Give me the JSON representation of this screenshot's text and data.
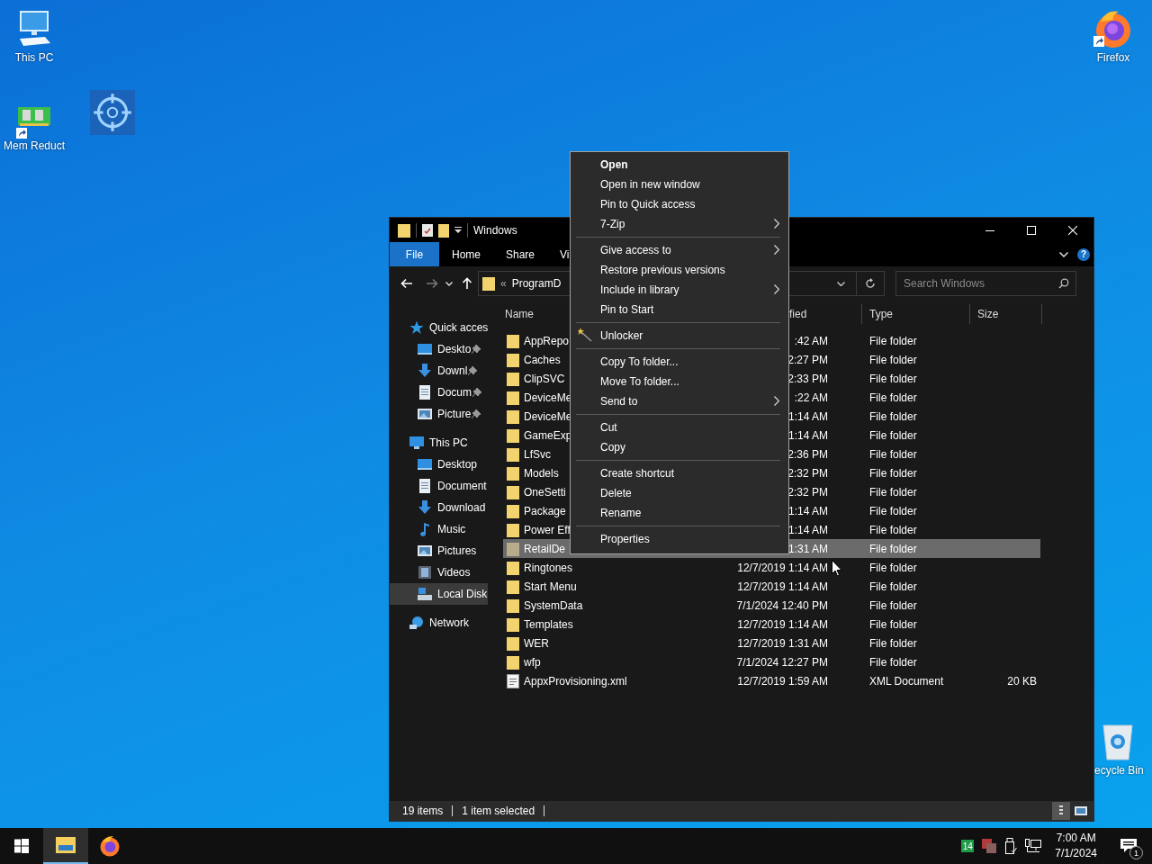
{
  "desktop": {
    "icons": [
      {
        "kind": "computer",
        "label": "This PC"
      },
      {
        "kind": "memory",
        "label": "Mem Reduct",
        "shortcut": true
      },
      {
        "kind": "target"
      },
      {
        "kind": "firefox",
        "label": "Firefox",
        "shortcut": true
      },
      {
        "kind": "recycle",
        "label": "ecycle Bin"
      }
    ]
  },
  "explorer": {
    "title": "Windows",
    "ribbon_tabs": [
      {
        "kind": "file-menu",
        "label": "File"
      },
      {
        "kind": "tab",
        "label": "Home"
      },
      {
        "kind": "tab",
        "label": "Share"
      },
      {
        "kind": "tab",
        "label": "Vi"
      }
    ],
    "help": "?",
    "address": {
      "overflow": "«",
      "path": "ProgramD"
    },
    "search": {
      "placeholder": "Search Windows"
    },
    "nav": [
      {
        "kind": "quick-access",
        "label": "Quick acces",
        "selected": false,
        "children": [
          {
            "kind": "desktop",
            "label": "Deskto",
            "selected": false,
            "pinned": true
          },
          {
            "kind": "downloads",
            "label": "Downl",
            "selected": false,
            "pinned": true
          },
          {
            "kind": "documents",
            "label": "Docum",
            "selected": false,
            "pinned": true
          },
          {
            "kind": "pictures",
            "label": "Picture",
            "selected": false,
            "pinned": true
          }
        ]
      },
      {
        "kind": "pc",
        "label": "This PC",
        "selected": false,
        "children": [
          {
            "kind": "desktop",
            "label": "Desktop",
            "selected": false
          },
          {
            "kind": "documents",
            "label": "Document",
            "selected": false
          },
          {
            "kind": "downloads",
            "label": "Download",
            "selected": false
          },
          {
            "kind": "music",
            "label": "Music",
            "selected": false
          },
          {
            "kind": "pictures",
            "label": "Pictures",
            "selected": false
          },
          {
            "kind": "videos",
            "label": "Videos",
            "selected": false
          },
          {
            "kind": "disk",
            "label": "Local Disk",
            "selected": true
          }
        ]
      },
      {
        "kind": "network",
        "label": "Network",
        "selected": false
      }
    ],
    "columns": [
      "Name",
      "fied",
      "Type",
      "Size"
    ],
    "rows": [
      {
        "kind": "folder",
        "name": "AppRepo",
        "date": ":42 AM",
        "type": "File folder",
        "selected": false
      },
      {
        "kind": "folder",
        "name": "Caches",
        "date": "2:27 PM",
        "type": "File folder",
        "selected": false
      },
      {
        "kind": "folder",
        "name": "ClipSVC",
        "date": "2:33 PM",
        "type": "File folder",
        "selected": false
      },
      {
        "kind": "folder",
        "name": "DeviceMe",
        "date": ":22 AM",
        "type": "File folder",
        "selected": false
      },
      {
        "kind": "folder",
        "name": "DeviceMe",
        "date": "1:14 AM",
        "type": "File folder",
        "selected": false
      },
      {
        "kind": "folder",
        "name": "GameExp",
        "date": "1:14 AM",
        "type": "File folder",
        "selected": false
      },
      {
        "kind": "folder",
        "name": "LfSvc",
        "date": "2:36 PM",
        "type": "File folder",
        "selected": false
      },
      {
        "kind": "folder",
        "name": "Models",
        "date": "2:32 PM",
        "type": "File folder",
        "selected": false
      },
      {
        "kind": "folder",
        "name": "OneSetti",
        "date": "2:32 PM",
        "type": "File folder",
        "selected": false
      },
      {
        "kind": "folder",
        "name": "Package",
        "date": "1:14 AM",
        "type": "File folder",
        "selected": false
      },
      {
        "kind": "folder",
        "name": "Power Eff",
        "date": "1:14 AM",
        "type": "File folder",
        "selected": false
      },
      {
        "kind": "folder",
        "name": "RetailDe",
        "date": "1:31 AM",
        "type": "File folder",
        "selected": true
      },
      {
        "kind": "folder",
        "name": "Ringtones",
        "date": "12/7/2019 1:14 AM",
        "type": "File folder",
        "selected": false
      },
      {
        "kind": "folder",
        "name": "Start Menu",
        "date": "12/7/2019 1:14 AM",
        "type": "File folder",
        "selected": false
      },
      {
        "kind": "folder",
        "name": "SystemData",
        "date": "7/1/2024 12:40 PM",
        "type": "File folder",
        "selected": false
      },
      {
        "kind": "folder",
        "name": "Templates",
        "date": "12/7/2019 1:14 AM",
        "type": "File folder",
        "selected": false
      },
      {
        "kind": "folder",
        "name": "WER",
        "date": "12/7/2019 1:31 AM",
        "type": "File folder",
        "selected": false
      },
      {
        "kind": "folder",
        "name": "wfp",
        "date": "7/1/2024 12:27 PM",
        "type": "File folder",
        "selected": false
      },
      {
        "kind": "file",
        "name": "AppxProvisioning.xml",
        "date": "12/7/2019 1:59 AM",
        "type": "XML Document",
        "size": "20 KB",
        "selected": false
      }
    ],
    "status": [
      "19 items",
      "1 item selected"
    ]
  },
  "context_menu": [
    {
      "kind": "item",
      "label": "Open",
      "default": true,
      "submenu": false
    },
    {
      "kind": "item",
      "label": "Open in new window",
      "default": false,
      "submenu": false
    },
    {
      "kind": "item",
      "label": "Pin to Quick access",
      "default": false,
      "submenu": false
    },
    {
      "kind": "item",
      "label": "7-Zip",
      "default": false,
      "submenu": true
    },
    {
      "kind": "separator"
    },
    {
      "kind": "item",
      "label": "Give access to",
      "default": false,
      "submenu": true
    },
    {
      "kind": "item",
      "label": "Restore previous versions",
      "default": false,
      "submenu": false
    },
    {
      "kind": "item",
      "label": "Include in library",
      "default": false,
      "submenu": true
    },
    {
      "kind": "item",
      "label": "Pin to Start",
      "default": false,
      "submenu": false
    },
    {
      "kind": "separator"
    },
    {
      "kind": "icon-item",
      "label": "Unlocker",
      "default": false,
      "submenu": false
    },
    {
      "kind": "separator"
    },
    {
      "kind": "item",
      "label": "Copy To folder...",
      "default": false,
      "submenu": false
    },
    {
      "kind": "item",
      "label": "Move To folder...",
      "default": false,
      "submenu": false
    },
    {
      "kind": "item",
      "label": "Send to",
      "default": false,
      "submenu": true
    },
    {
      "kind": "separator"
    },
    {
      "kind": "item",
      "label": "Cut",
      "default": false,
      "submenu": false
    },
    {
      "kind": "item",
      "label": "Copy",
      "default": false,
      "submenu": false
    },
    {
      "kind": "separator"
    },
    {
      "kind": "item",
      "label": "Create shortcut",
      "default": false,
      "submenu": false
    },
    {
      "kind": "item",
      "label": "Delete",
      "default": false,
      "submenu": false
    },
    {
      "kind": "item",
      "label": "Rename",
      "default": false,
      "submenu": false
    },
    {
      "kind": "separator"
    },
    {
      "kind": "item",
      "label": "Properties",
      "default": false,
      "submenu": false
    }
  ],
  "taskbar": {
    "buttons": [
      {
        "kind": "start"
      },
      {
        "kind": "explorer",
        "selected": true
      },
      {
        "kind": "firefox",
        "selected": false
      }
    ],
    "tray": [
      {
        "kind": "counter",
        "text": "14"
      },
      {
        "kind": "app"
      },
      {
        "kind": "usb"
      },
      {
        "kind": "network"
      }
    ],
    "time": "7:00 AM",
    "date": "7/1/2024",
    "notifications": "1"
  }
}
